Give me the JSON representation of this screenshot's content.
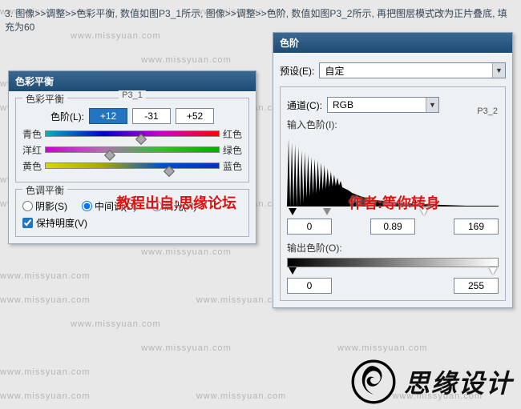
{
  "watermark": "www.missyuan.com",
  "top_instruction": "3. 图像>>调整>>色彩平衡, 数值如图P3_1所示, 图像>>调整>>色阶, 数值如图P3_2所示, 再把图层模式改为正片叠底, 填充为60",
  "color_balance": {
    "title": "色彩平衡",
    "fig": "P3_1",
    "group_label": "色彩平衡",
    "level_label": "色阶(L):",
    "values": {
      "a": "+12",
      "b": "-31",
      "c": "+52"
    },
    "sliders": [
      {
        "left": "青色",
        "right": "红色"
      },
      {
        "left": "洋红",
        "right": "绿色"
      },
      {
        "left": "黄色",
        "right": "蓝色"
      }
    ],
    "tone_group": "色调平衡",
    "tones": {
      "shadow": "阴影(S)",
      "mid": "中间调(D)",
      "high": "高光(H)"
    },
    "preserve": "保持明度(V)"
  },
  "levels": {
    "title": "色阶",
    "fig": "P3_2",
    "preset_label": "预设(E):",
    "preset_value": "自定",
    "channel_label": "通道(C):",
    "channel_value": "RGB",
    "input_label": "输入色阶(I):",
    "input": {
      "black": "0",
      "gamma": "0.89",
      "white": "169"
    },
    "output_label": "输出色阶(O):",
    "output": {
      "black": "0",
      "white": "255"
    }
  },
  "annotations": {
    "tutorial": "教程出自:思缘论坛",
    "author": "作者:等你转身"
  },
  "logo_text": "思缘设计"
}
